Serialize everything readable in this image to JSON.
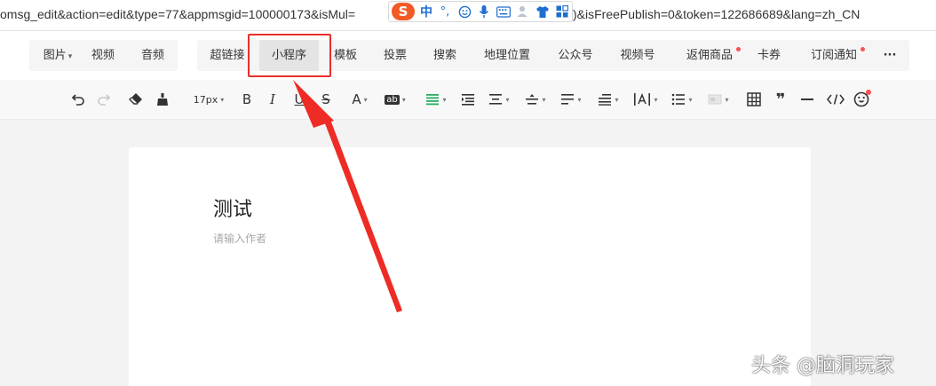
{
  "urlbar": {
    "left_text": "omsg_edit&action=edit&type=77&appmsgid=100000173&isMul=",
    "right_text": ")&isFreePublish=0&token=122686689&lang=zh_CN"
  },
  "ime": {
    "logo": "S",
    "lang": "中",
    "punct": "°,",
    "icons": [
      "smiley-icon",
      "microphone-icon",
      "keyboard-icon",
      "user-settings-icon",
      "shirt-icon",
      "grid-icon"
    ]
  },
  "menu": {
    "group1": [
      {
        "label": "图片",
        "caret": "▾"
      },
      {
        "label": "视频"
      },
      {
        "label": "音频"
      }
    ],
    "group2": [
      {
        "label": "超链接"
      },
      {
        "label": "小程序",
        "selected": true
      },
      {
        "label": "模板"
      },
      {
        "label": "投票"
      },
      {
        "label": "搜索"
      },
      {
        "label": "地理位置"
      },
      {
        "label": "公众号"
      },
      {
        "label": "视频号"
      },
      {
        "label": "返佣商品",
        "dot": true
      },
      {
        "label": "卡券"
      },
      {
        "label": "订阅通知",
        "dot": true
      },
      {
        "label": "···"
      }
    ]
  },
  "toolbar": {
    "font_size": "17px",
    "bold": "B",
    "italic": "I",
    "underline": "U",
    "strike": "S",
    "font_color": "A",
    "bg_color": "ab",
    "caret": "▾",
    "quote": "❞"
  },
  "editor": {
    "title": "测试",
    "author_placeholder": "请输入作者"
  },
  "watermark": "头条 @脑洞玩家",
  "colors": {
    "accent_red": "#e8302b",
    "notice_dot": "#fa5151",
    "align_green": "#2aae67",
    "ime_orange": "#f25a26"
  }
}
